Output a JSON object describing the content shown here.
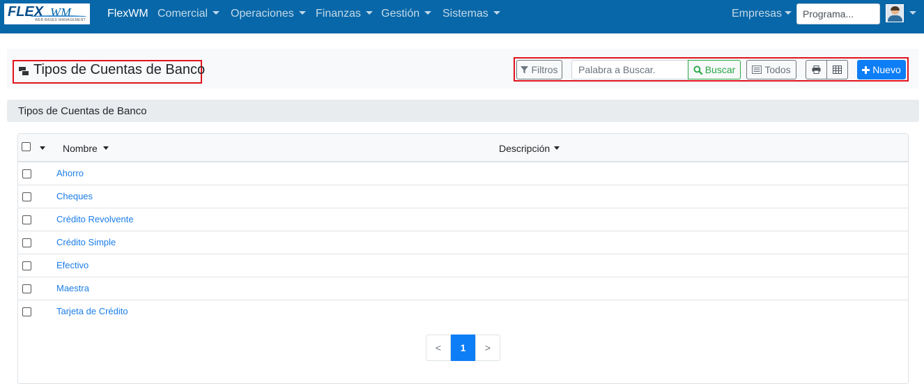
{
  "app": {
    "brand": "FlexWM",
    "logo_text": "FLEX",
    "logo_suffix": "WM",
    "logo_tagline": "WEB BASED MANAGEMENT"
  },
  "nav": {
    "menus": [
      {
        "label": "Comercial"
      },
      {
        "label": "Operaciones"
      },
      {
        "label": "Finanzas"
      },
      {
        "label": "Gestión"
      },
      {
        "label": "Sistemas"
      }
    ],
    "empresas_label": "Empresas",
    "program_search_placeholder": "Programa..."
  },
  "header": {
    "title": "Tipos de Cuentas de Banco",
    "filtros_label": "Filtros",
    "search_placeholder": "Palabra a Buscar.",
    "buscar_label": "Buscar",
    "todos_label": "Todos",
    "nuevo_label": "Nuevo"
  },
  "section": {
    "title": "Tipos de Cuentas de Banco"
  },
  "table": {
    "columns": [
      "Nombre",
      "Descripción"
    ],
    "rows": [
      {
        "nombre": "Ahorro",
        "descripcion": ""
      },
      {
        "nombre": "Cheques",
        "descripcion": ""
      },
      {
        "nombre": "Crédito Revolvente",
        "descripcion": ""
      },
      {
        "nombre": "Crédito Simple",
        "descripcion": ""
      },
      {
        "nombre": "Efectivo",
        "descripcion": ""
      },
      {
        "nombre": "Maestra",
        "descripcion": ""
      },
      {
        "nombre": "Tarjeta de Crédito",
        "descripcion": ""
      }
    ]
  },
  "pagination": {
    "prev_label": "<",
    "current_page": "1",
    "next_label": ">"
  },
  "colors": {
    "navbar": "#0867a8",
    "primary": "#0d7ef5",
    "success": "#28a745",
    "highlight_border": "#e0141e",
    "link": "#1a7de8"
  }
}
